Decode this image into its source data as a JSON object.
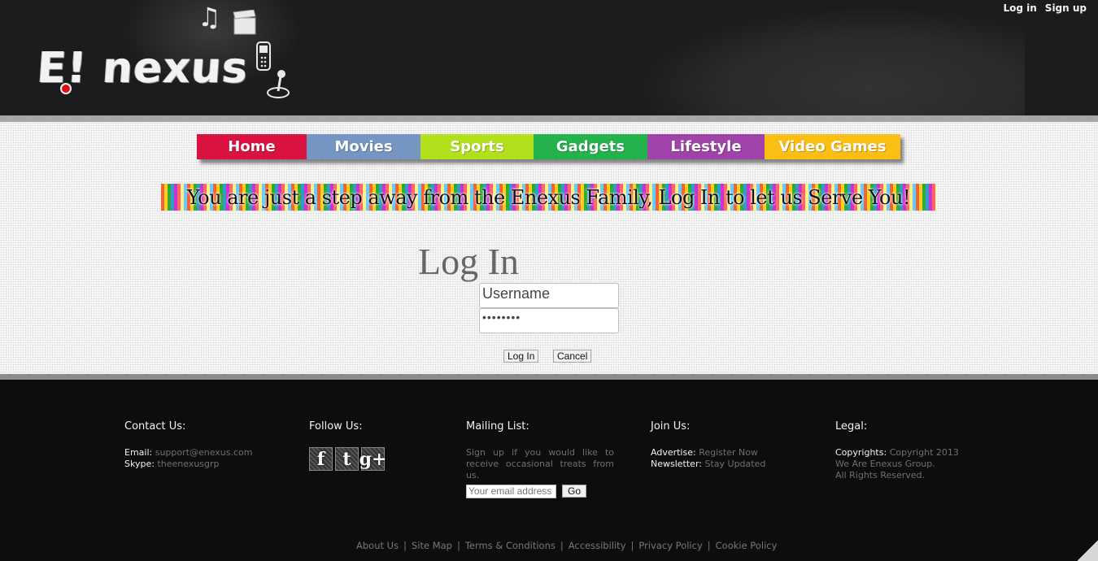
{
  "header": {
    "logo_text": "E! nexus",
    "top_links": [
      "Log in",
      "Sign up"
    ]
  },
  "nav": [
    {
      "label": "Home",
      "color": "#d9123f"
    },
    {
      "label": "Movies",
      "color": "#7595c3"
    },
    {
      "label": "Sports",
      "color": "#b3e01d"
    },
    {
      "label": "Gadgets",
      "color": "#23b24b"
    },
    {
      "label": "Lifestyle",
      "color": "#a043a8"
    },
    {
      "label": "Video Games",
      "color": "#fbbe15"
    }
  ],
  "banner": "You are just a step away from the Enexus Family, Log In to let us Serve You!",
  "login": {
    "title": "Log In",
    "username_value": "Username",
    "password_value": "••••••••",
    "login_button": "Log In",
    "cancel_button": "Cancel"
  },
  "footer": {
    "contact": {
      "title": "Contact Us:",
      "email_label": "Email:",
      "email_value": "support@enexus.com",
      "skype_label": "Skype:",
      "skype_value": "theenexusgrp"
    },
    "follow": {
      "title": "Follow Us:",
      "icons": [
        "f",
        "t",
        "g+"
      ]
    },
    "mailing": {
      "title": "Mailing List:",
      "text": "Sign up if you would like to receive occasional treats from us.",
      "placeholder": "Your email address",
      "go_button": "Go"
    },
    "join": {
      "title": "Join Us:",
      "advertise_label": "Advertise:",
      "advertise_value": "Register Now",
      "newsletter_label": "Newsletter:",
      "newsletter_value": "Stay Updated"
    },
    "legal": {
      "title": "Legal:",
      "copyright_label": "Copyrights:",
      "copyright_value": "Copyright 2013",
      "line2": "We Are Enexus Group.",
      "line3": "All Rights Reserved."
    },
    "links": [
      "About Us",
      "Site Map",
      "Terms & Conditions",
      "Accessibility",
      "Privacy Policy",
      "Cookie Policy"
    ]
  }
}
